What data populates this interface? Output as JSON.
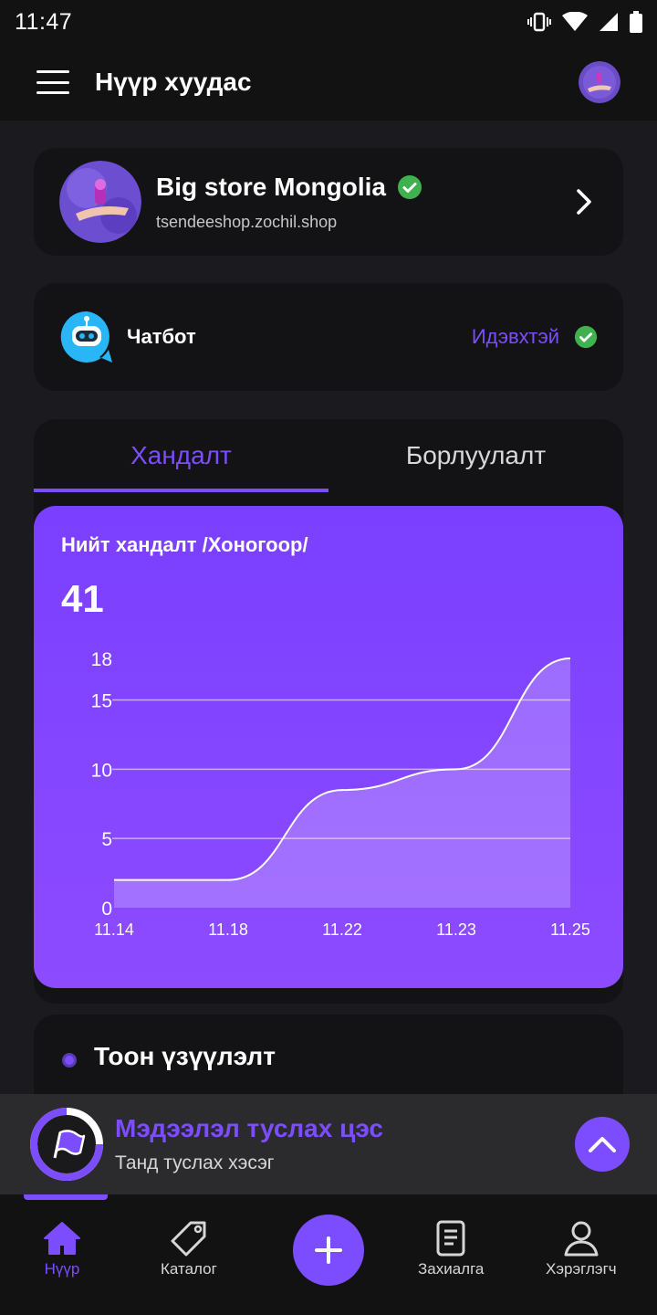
{
  "status_bar": {
    "time": "11:47"
  },
  "app_bar": {
    "title": "Нүүр хуудас"
  },
  "store": {
    "name": "Big store Mongolia",
    "url": "tsendeeshop.zochil.shop"
  },
  "chatbot": {
    "label": "Чатбот",
    "status": "Идэвхтэй"
  },
  "tabs": [
    {
      "label": "Хандалт",
      "active": true
    },
    {
      "label": "Борлуулалт",
      "active": false
    }
  ],
  "chart_data": {
    "type": "area",
    "title": "Нийт хандалт /Хоногоор/",
    "total": "41",
    "categories": [
      "11.14",
      "11.18",
      "11.22",
      "11.23",
      "11.25"
    ],
    "values": [
      2,
      2,
      8.5,
      10,
      18
    ],
    "yticks": [
      0,
      5,
      10,
      15,
      18
    ],
    "ylim": [
      0,
      18
    ],
    "grid": true
  },
  "stats": {
    "title": "Тоон үзүүлэлт"
  },
  "help": {
    "title": "Мэдээлэл туслах цэс",
    "subtitle": "Танд туслах хэсэг"
  },
  "bottom_nav": [
    {
      "label": "Нүүр",
      "icon": "home-icon",
      "active": true
    },
    {
      "label": "Каталог",
      "icon": "tag-icon",
      "active": false
    },
    {
      "label": "Захиалга",
      "icon": "document-icon",
      "active": false
    },
    {
      "label": "Хэрэглэгч",
      "icon": "user-icon",
      "active": false
    }
  ],
  "colors": {
    "accent": "#7c4dff",
    "success": "#3fb24f",
    "chatbot": "#29b6f6"
  }
}
